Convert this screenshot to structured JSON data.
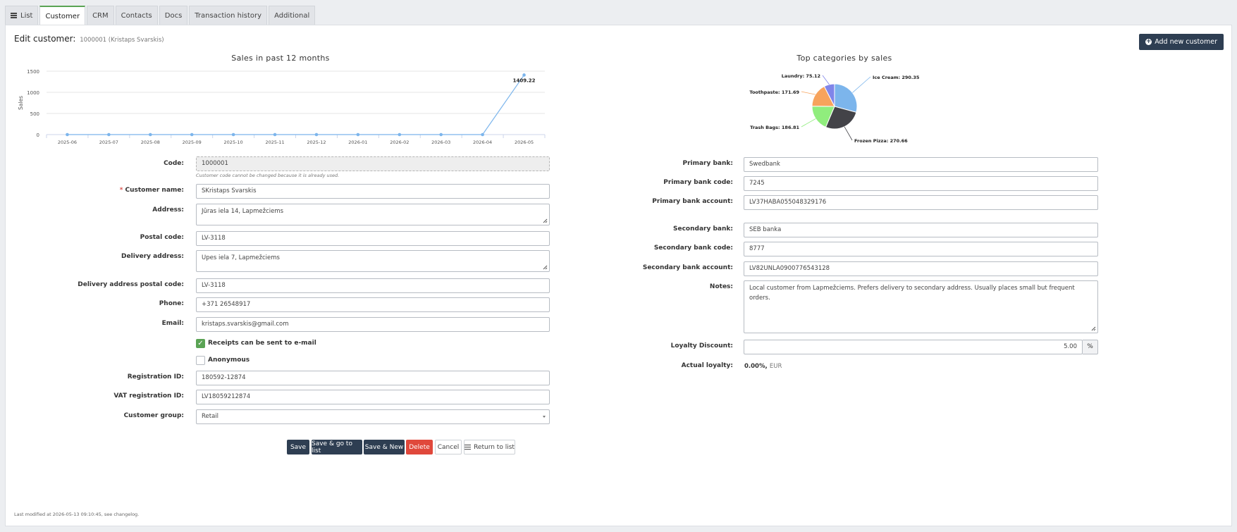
{
  "tabs": [
    {
      "label": "List"
    },
    {
      "label": "Customer"
    },
    {
      "label": "CRM"
    },
    {
      "label": "Contacts"
    },
    {
      "label": "Docs"
    },
    {
      "label": "Transaction history"
    },
    {
      "label": "Additional"
    }
  ],
  "header": {
    "title": "Edit customer:",
    "subtitle": "1000001 (Kristaps Svarskis)",
    "add_button": "Add new customer"
  },
  "chart_data": [
    {
      "type": "line",
      "title": "Sales in past 12 months",
      "ylabel": "Sales",
      "xlabel": "",
      "x": [
        "2025-06",
        "2025-07",
        "2025-08",
        "2025-09",
        "2025-10",
        "2025-11",
        "2025-12",
        "2026-01",
        "2026-02",
        "2026-03",
        "2026-04",
        "2026-05"
      ],
      "values": [
        0,
        0,
        0,
        0,
        0,
        0,
        0,
        0,
        0,
        0,
        0,
        1409.22
      ],
      "yticks": [
        0,
        500,
        1000,
        1500
      ],
      "ylim": [
        0,
        1500
      ],
      "data_label": "1409.22",
      "color": "#7cb5ec",
      "grid": true
    },
    {
      "type": "pie",
      "title": "Top categories by sales",
      "slices": [
        {
          "label": "Ice Cream",
          "value": 290.35,
          "text": "Ice Cream: 290.35",
          "color": "#7cb5ec"
        },
        {
          "label": "Frozen Pizza",
          "value": 270.66,
          "text": "Frozen Pizza: 270.66",
          "color": "#434348"
        },
        {
          "label": "Trash Bags",
          "value": 186.81,
          "text": "Trash Bags: 186.81",
          "color": "#90ed7d"
        },
        {
          "label": "Toothpaste",
          "value": 171.69,
          "text": "Toothpaste: 171.69",
          "color": "#f7a35c"
        },
        {
          "label": "Laundry",
          "value": 75.12,
          "text": "Laundry: 75.12",
          "color": "#8085e9"
        }
      ]
    }
  ],
  "form": {
    "code_label": "Code:",
    "code_value": "1000001",
    "code_hint": "Customer code cannot be changed because it is already used.",
    "name_label": "Customer name:",
    "name_required": "*",
    "name_value": "SKristaps Svarskis",
    "address_label": "Address:",
    "address_value": "Jūras iela 14, Lapmežciems",
    "postal_label": "Postal code:",
    "postal_value": "LV-3118",
    "delivery_label": "Delivery address:",
    "delivery_value": "Upes iela 7, Lapmežciems",
    "delivery_postal_label": "Delivery address postal code:",
    "delivery_postal_value": "LV-3118",
    "phone_label": "Phone:",
    "phone_value": "+371 26548917",
    "email_label": "Email:",
    "email_value": "kristaps.svarskis@gmail.com",
    "receipts_label": "Receipts can be sent to e-mail",
    "receipts_checked": true,
    "anonymous_label": "Anonymous",
    "anonymous_checked": false,
    "regid_label": "Registration ID:",
    "regid_value": "180592-12874",
    "vat_label": "VAT registration ID:",
    "vat_value": "LV18059212874",
    "group_label": "Customer group:",
    "group_value": "Retail"
  },
  "bank": {
    "primary_bank_label": "Primary bank:",
    "primary_bank_value": "Swedbank",
    "primary_code_label": "Primary bank code:",
    "primary_code_value": "7245",
    "primary_account_label": "Primary bank account:",
    "primary_account_value": "LV37HABA055048329176",
    "secondary_bank_label": "Secondary bank:",
    "secondary_bank_value": "SEB banka",
    "secondary_code_label": "Secondary bank code:",
    "secondary_code_value": "8777",
    "secondary_account_label": "Secondary bank account:",
    "secondary_account_value": "LV82UNLA0900776543128",
    "notes_label": "Notes:",
    "notes_value": "Local customer from Lapmežciems. Prefers delivery to secondary address. Usually places small but frequent orders.",
    "loyalty_label": "Loyalty Discount:",
    "loyalty_value": "5.00",
    "loyalty_unit": "%",
    "actual_loyalty_label": "Actual loyalty:",
    "actual_loyalty_value": "0.00%,",
    "actual_loyalty_currency": "EUR"
  },
  "buttons": {
    "save": "Save",
    "save_go_list": "Save & go to list",
    "save_new": "Save & New",
    "delete": "Delete",
    "cancel": "Cancel",
    "return_list": "Return to list"
  },
  "footer": {
    "text": "Last modified at 2026-05-13 09:10:45, see changelog."
  }
}
